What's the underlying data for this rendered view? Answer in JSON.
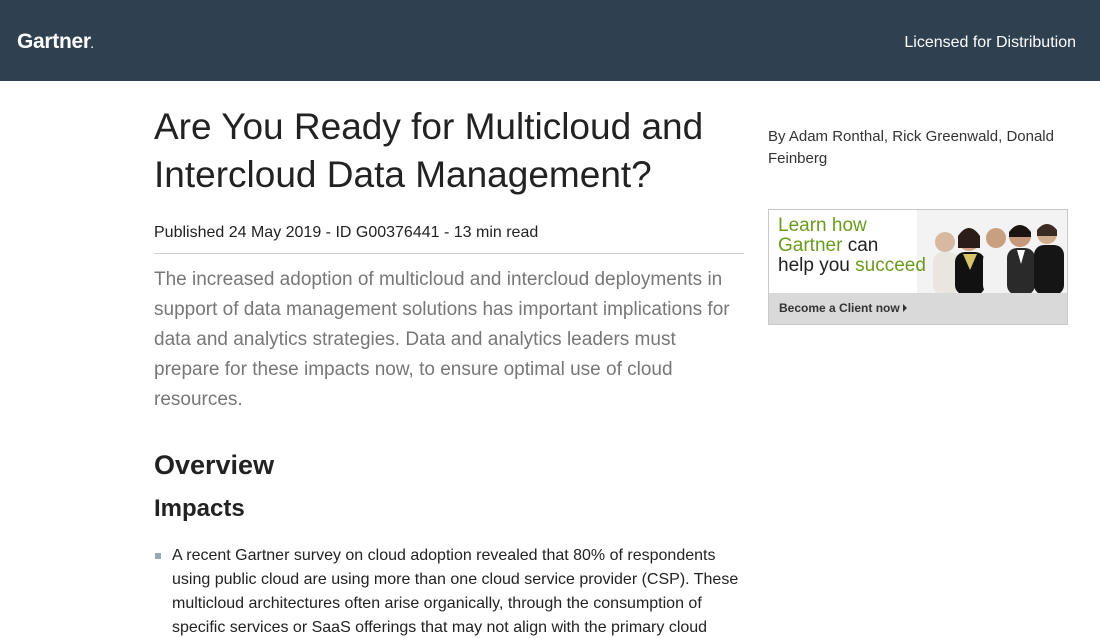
{
  "header": {
    "logo": "Gartner",
    "logo_dot": ".",
    "licensed": "Licensed for Distribution"
  },
  "article": {
    "title": "Are You Ready for Multicloud and Intercloud Data Management?",
    "meta": "Published 24 May 2019 - ID G00376441 - 13 min read",
    "summary": "The increased adoption of multicloud and intercloud deployments in support of data management solutions has important implications for data and analytics strategies. Data and analytics leaders must prepare for these impacts now, to ensure optimal use of cloud resources.",
    "overview_heading": "Overview",
    "impacts_heading": "Impacts",
    "impacts": [
      "A recent Gartner survey on cloud adoption revealed that 80% of respondents using public cloud are using more than one cloud service provider (CSP). These multicloud architectures often arise organically, through the consumption of specific services or SaaS offerings that may not align with the primary cloud"
    ]
  },
  "sidebar": {
    "authors": "By Adam Ronthal, Rick Greenwald, Donald Feinberg"
  },
  "promo": {
    "line1": "Learn how",
    "line2a": "Gartner",
    "line2b": " can",
    "line3a": "help you ",
    "line3b": "succeed",
    "cta": "Become a Client now",
    "icon": "people-photo"
  },
  "colors": {
    "header_bg": "#2f4050",
    "promo_green": "#6a9b1e",
    "summary_text": "#777777"
  }
}
